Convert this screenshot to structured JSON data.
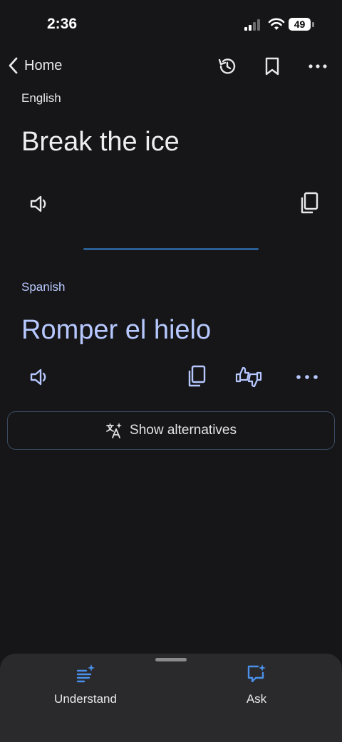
{
  "status_bar": {
    "time": "2:36",
    "battery": "49"
  },
  "header": {
    "back_label": "Home"
  },
  "source": {
    "language": "English",
    "text": "Break the ice"
  },
  "target": {
    "language": "Spanish",
    "text": "Romper el hielo"
  },
  "alternatives_button": {
    "label": "Show alternatives"
  },
  "bottom_tabs": [
    {
      "label": "Understand"
    },
    {
      "label": "Ask"
    }
  ],
  "colors": {
    "background": "#161618",
    "accent_blue": "#b6c8ff",
    "icon_blue": "#4a8fe8",
    "divider": "#2b5f93"
  }
}
